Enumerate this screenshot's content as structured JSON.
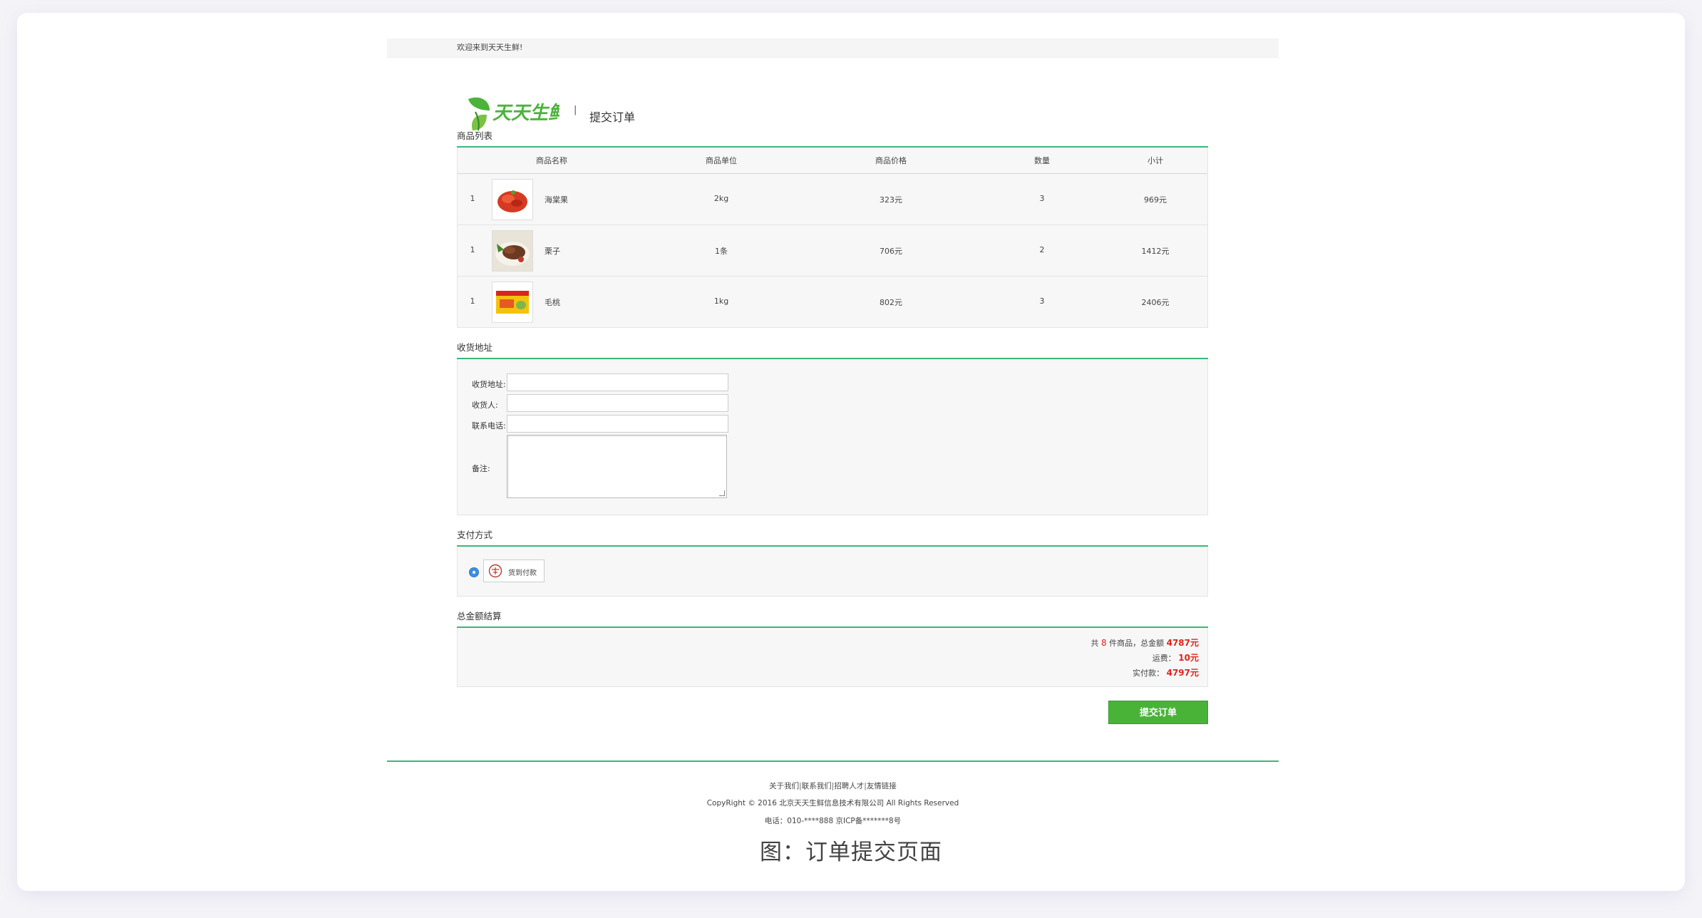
{
  "topbar": {
    "welcome": "欢迎来到天天生鲜!"
  },
  "header": {
    "logo_text": "天天生鲜",
    "separator": "|",
    "title": "提交订单"
  },
  "goods": {
    "section_title": "商品列表",
    "columns": [
      "商品名称",
      "商品单位",
      "商品价格",
      "数量",
      "小计"
    ],
    "rows": [
      {
        "index": "1",
        "name": "海棠果",
        "unit": "2kg",
        "price": "323元",
        "qty": "3",
        "subtotal": "969元",
        "thumb": "red-fruit"
      },
      {
        "index": "1",
        "name": "栗子",
        "unit": "1条",
        "price": "706元",
        "qty": "2",
        "subtotal": "1412元",
        "thumb": "meat-dish"
      },
      {
        "index": "1",
        "name": "毛桃",
        "unit": "1kg",
        "price": "802元",
        "qty": "3",
        "subtotal": "2406元",
        "thumb": "yellow-package"
      }
    ]
  },
  "address": {
    "section_title": "收货地址",
    "fields": {
      "address_label": "收货地址:",
      "receiver_label": "收货人:",
      "phone_label": "联系电话:",
      "note_label": "备注:"
    }
  },
  "payment": {
    "section_title": "支付方式",
    "option_label": "货到付款",
    "selected": true
  },
  "totals": {
    "section_title": "总金额结算",
    "line1_prefix": "共",
    "count": "8",
    "line1_mid": "件商品，总金额",
    "total_amount": "4787元",
    "shipping_label": "运费：",
    "shipping": "10元",
    "pay_label": "实付款：",
    "pay_amount": "4797元"
  },
  "submit_label": "提交订单",
  "footer": {
    "links": [
      "关于我们",
      "联系我们",
      "招聘人才",
      "友情链接"
    ],
    "separator": "|",
    "copyright": "CopyRight © 2016 北京天天生鲜信息技术有限公司 All Rights Reserved",
    "contact": "电话：010-****888 京ICP备*******8号"
  },
  "caption": "图：订单提交页面",
  "colors": {
    "accent": "#3bb878",
    "submit": "#48b337",
    "price_red": "#e2231a"
  }
}
